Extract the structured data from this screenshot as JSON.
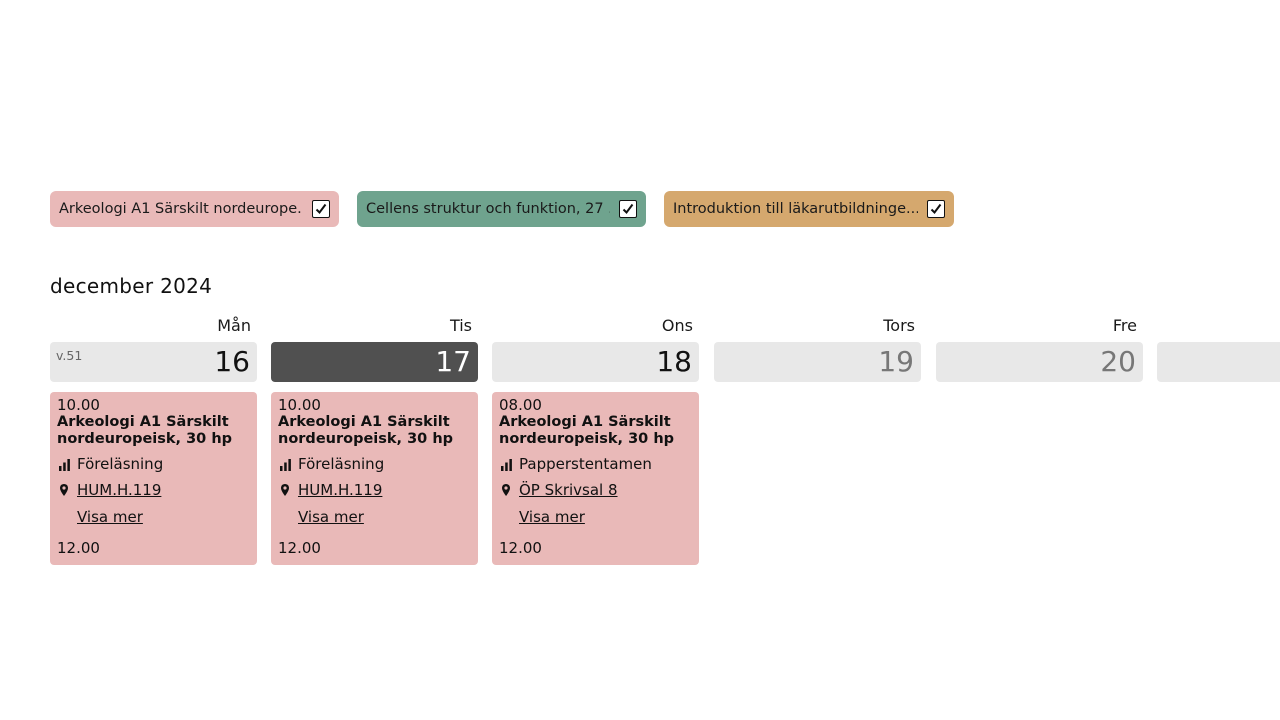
{
  "filters": [
    {
      "label": "Arkeologi A1 Särskilt nordeurope...",
      "checked": true,
      "color": "#e9b9b8"
    },
    {
      "label": "Cellens struktur och funktion, 27 ...",
      "checked": true,
      "color": "#6fa38e"
    },
    {
      "label": "Introduktion till läkarutbildninge...",
      "checked": true,
      "color": "#d5a86e"
    }
  ],
  "month_title": "december 2024",
  "week_label": "v.51",
  "days": [
    {
      "name": "Mån",
      "date": "16"
    },
    {
      "name": "Tis",
      "date": "17"
    },
    {
      "name": "Ons",
      "date": "18"
    },
    {
      "name": "Tors",
      "date": "19"
    },
    {
      "name": "Fre",
      "date": "20"
    }
  ],
  "events": [
    {
      "start": "10.00",
      "title": "Arkeologi A1 Särskilt nordeuropeisk, 30 hp",
      "type": "Föreläsning",
      "location": "HUM.H.119",
      "more": "Visa mer",
      "end": "12.00"
    },
    {
      "start": "10.00",
      "title": "Arkeologi A1 Särskilt nordeuropeisk, 30 hp",
      "type": "Föreläsning",
      "location": "HUM.H.119",
      "more": "Visa mer",
      "end": "12.00"
    },
    {
      "start": "08.00",
      "title": "Arkeologi A1 Särskilt nordeuropeisk, 30 hp",
      "type": "Papperstentamen",
      "location": "ÖP Skrivsal 8",
      "more": "Visa mer",
      "end": "12.00"
    }
  ],
  "colors": {
    "event_bg": "#e9b9b8",
    "today_bg": "#505050",
    "day_bg": "#e8e8e8"
  },
  "icons": {
    "type": "bar-chart-icon",
    "location": "map-pin-icon",
    "checkbox": "checkmark-icon"
  }
}
